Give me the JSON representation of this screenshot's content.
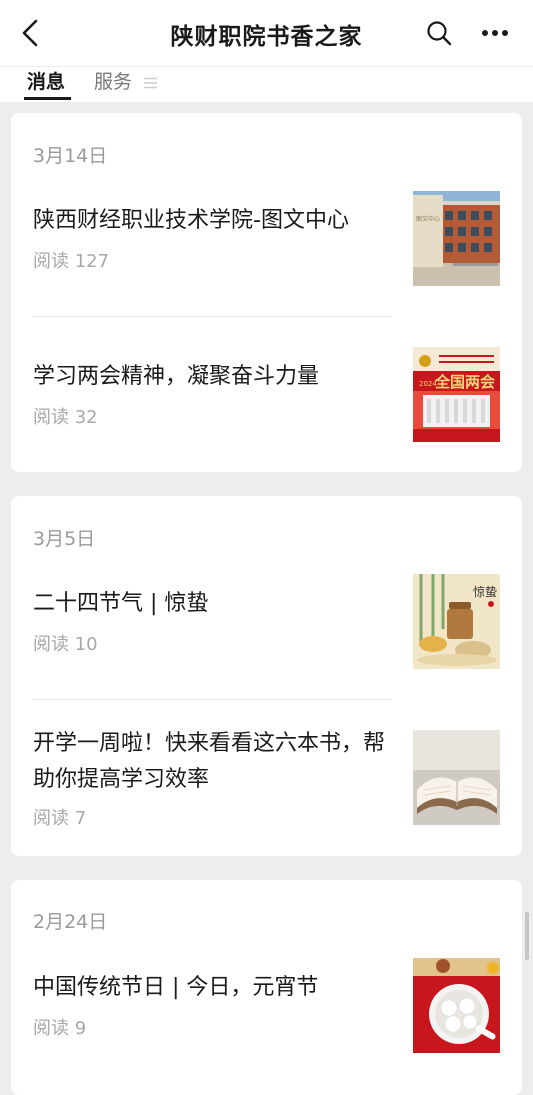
{
  "header": {
    "title": "陕财职院书香之家",
    "back_icon": "chevron-left-icon",
    "search_icon": "search-icon",
    "more_icon": "more-dots-icon"
  },
  "tabs": [
    {
      "label": "消息",
      "active": true
    },
    {
      "label": "服务",
      "active": false
    }
  ],
  "groups": [
    {
      "date": "3月14日",
      "articles": [
        {
          "title": "陕西财经职业技术学院-图文中心",
          "reads": "阅读 127"
        },
        {
          "title": "学习两会精神，凝聚奋斗力量",
          "reads": "阅读 32"
        }
      ]
    },
    {
      "date": "3月5日",
      "articles": [
        {
          "title": "二十四节气 | 惊蛰",
          "reads": "阅读 10"
        },
        {
          "title": "开学一周啦！快来看看这六本书，帮助你提高学习效率",
          "reads": "阅读 7"
        }
      ]
    },
    {
      "date": "2月24日",
      "articles": [
        {
          "title": "中国传统节日 | 今日，元宵节",
          "reads": "阅读 9"
        }
      ]
    }
  ],
  "thumbnails": {
    "building": {
      "sign": "图文中心"
    },
    "lianghui": {
      "banner": "全国两会",
      "year": "2024"
    },
    "jingzhe": {
      "calligraphy": "惊蛰"
    }
  },
  "colors": {
    "background": "#ededed",
    "card": "#ffffff",
    "muted": "#a8a8a8",
    "text": "#1a1a1a",
    "festive_red": "#c8161d"
  }
}
